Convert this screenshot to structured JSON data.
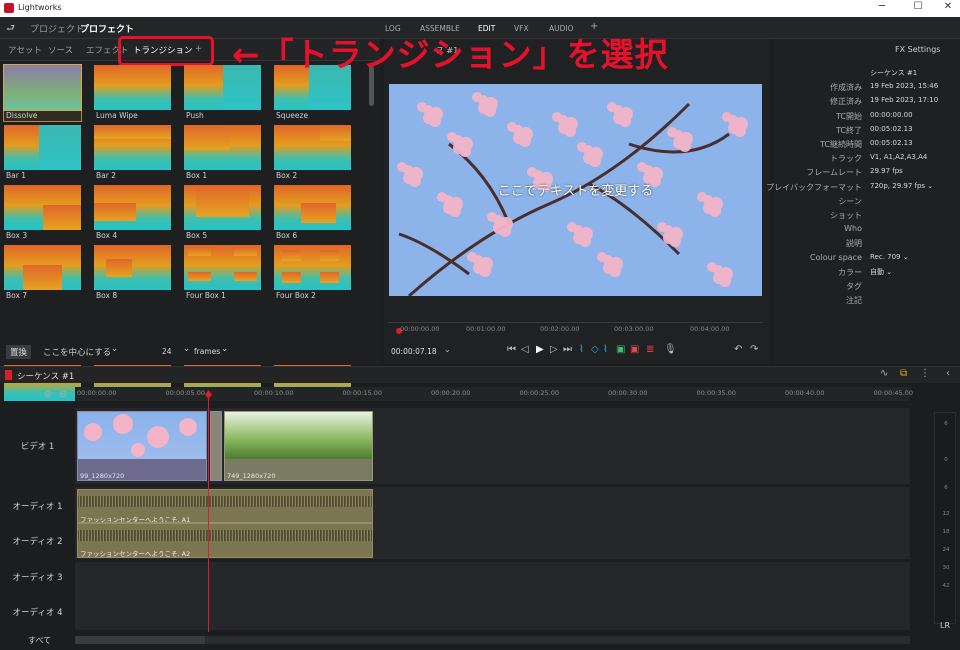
{
  "window": {
    "title": "Lightworks",
    "minimize": "─",
    "maximize": "☐",
    "close": "✕"
  },
  "projectbar": {
    "back": "⮐",
    "project_label": "プロジェクト",
    "project_name": "プロフェクト",
    "chev": "⌄"
  },
  "viewtabs": [
    "LOG",
    "ASSEMBLE",
    "EDIT",
    "VFX",
    "AUDIO",
    "+"
  ],
  "lefttabs": [
    "アセット",
    "ソース",
    "エフェクト",
    "トランジション",
    "+"
  ],
  "annotation": "←「トランジション」を選択",
  "transitions": [
    "Dissolve",
    "Luma Wipe",
    "Push",
    "Squeeze",
    "Bar 1",
    "Bar 2",
    "Box 1",
    "Box 2",
    "Box 3",
    "Box 4",
    "Box 5",
    "Box 6",
    "Box 7",
    "Box 8",
    "Four Box 1",
    "Four Box 2"
  ],
  "leftbottom": {
    "replace": "置換",
    "center": "ここを中心にする",
    "chev": "⌄",
    "count": "24",
    "unit": "frames"
  },
  "viewer": {
    "tab_prefix": "ス #1",
    "overlay_text": "ここでテキストを変更する",
    "timecode": "00:00:07.18",
    "ticks": [
      "00:00:00.00",
      "00:01:00.00",
      "00:02:00.00",
      "00:03:00.00",
      "00:04:00.00"
    ]
  },
  "fxsettings": "FX Settings",
  "properties": [
    {
      "k": "",
      "v": "シーケンス #1"
    },
    {
      "k": "作成済み",
      "v": "19 Feb 2023, 15:46"
    },
    {
      "k": "修正済み",
      "v": "19 Feb 2023, 17:10"
    },
    {
      "k": "TC開始",
      "v": "00:00:00.00"
    },
    {
      "k": "TC終了",
      "v": "00:05:02.13"
    },
    {
      "k": "TC継続時間",
      "v": "00:05:02.13"
    },
    {
      "k": "トラック",
      "v": "V1, A1,A2,A3,A4"
    },
    {
      "k": "フレームレート",
      "v": "29.97 fps"
    },
    {
      "k": "プレイバックフォーマット",
      "v": "720p, 29.97 fps ⌄"
    },
    {
      "k": "シーン",
      "v": ""
    },
    {
      "k": "ショット",
      "v": ""
    },
    {
      "k": "Who",
      "v": ""
    },
    {
      "k": "説明",
      "v": ""
    },
    {
      "k": "Colour space",
      "v": "Rec. 709 ⌄"
    },
    {
      "k": "カラー",
      "v": "自動 ⌄"
    },
    {
      "k": "タグ",
      "v": ""
    },
    {
      "k": "注記",
      "v": ""
    }
  ],
  "sequence": {
    "name": "シーケンス #1",
    "all": "すべて",
    "lr": "LR"
  },
  "timeline_ticks": [
    "00:00:00.00",
    "00:00:05.00",
    "00:00:10.00",
    "00:00:15.00",
    "00:00:20.00",
    "00:00:25.00",
    "00:00:30.00",
    "00:00:35.00",
    "00:00:40.00",
    "00:00:45.00"
  ],
  "tracks": {
    "video": "ビデオ 1",
    "a1": "オーディオ 1",
    "a2": "オーディオ 2",
    "a3": "オーディオ 3",
    "a4": "オーディオ 4"
  },
  "clips": {
    "v1": "99_1280x720",
    "v2": "749_1280x720",
    "a1": "ファッションセンターへようこそ. A1",
    "a2": "ファッションセンターへようこそ. A2"
  },
  "meter_nums": [
    "6",
    "0",
    "6",
    "12",
    "18",
    "24",
    "30",
    "42"
  ]
}
